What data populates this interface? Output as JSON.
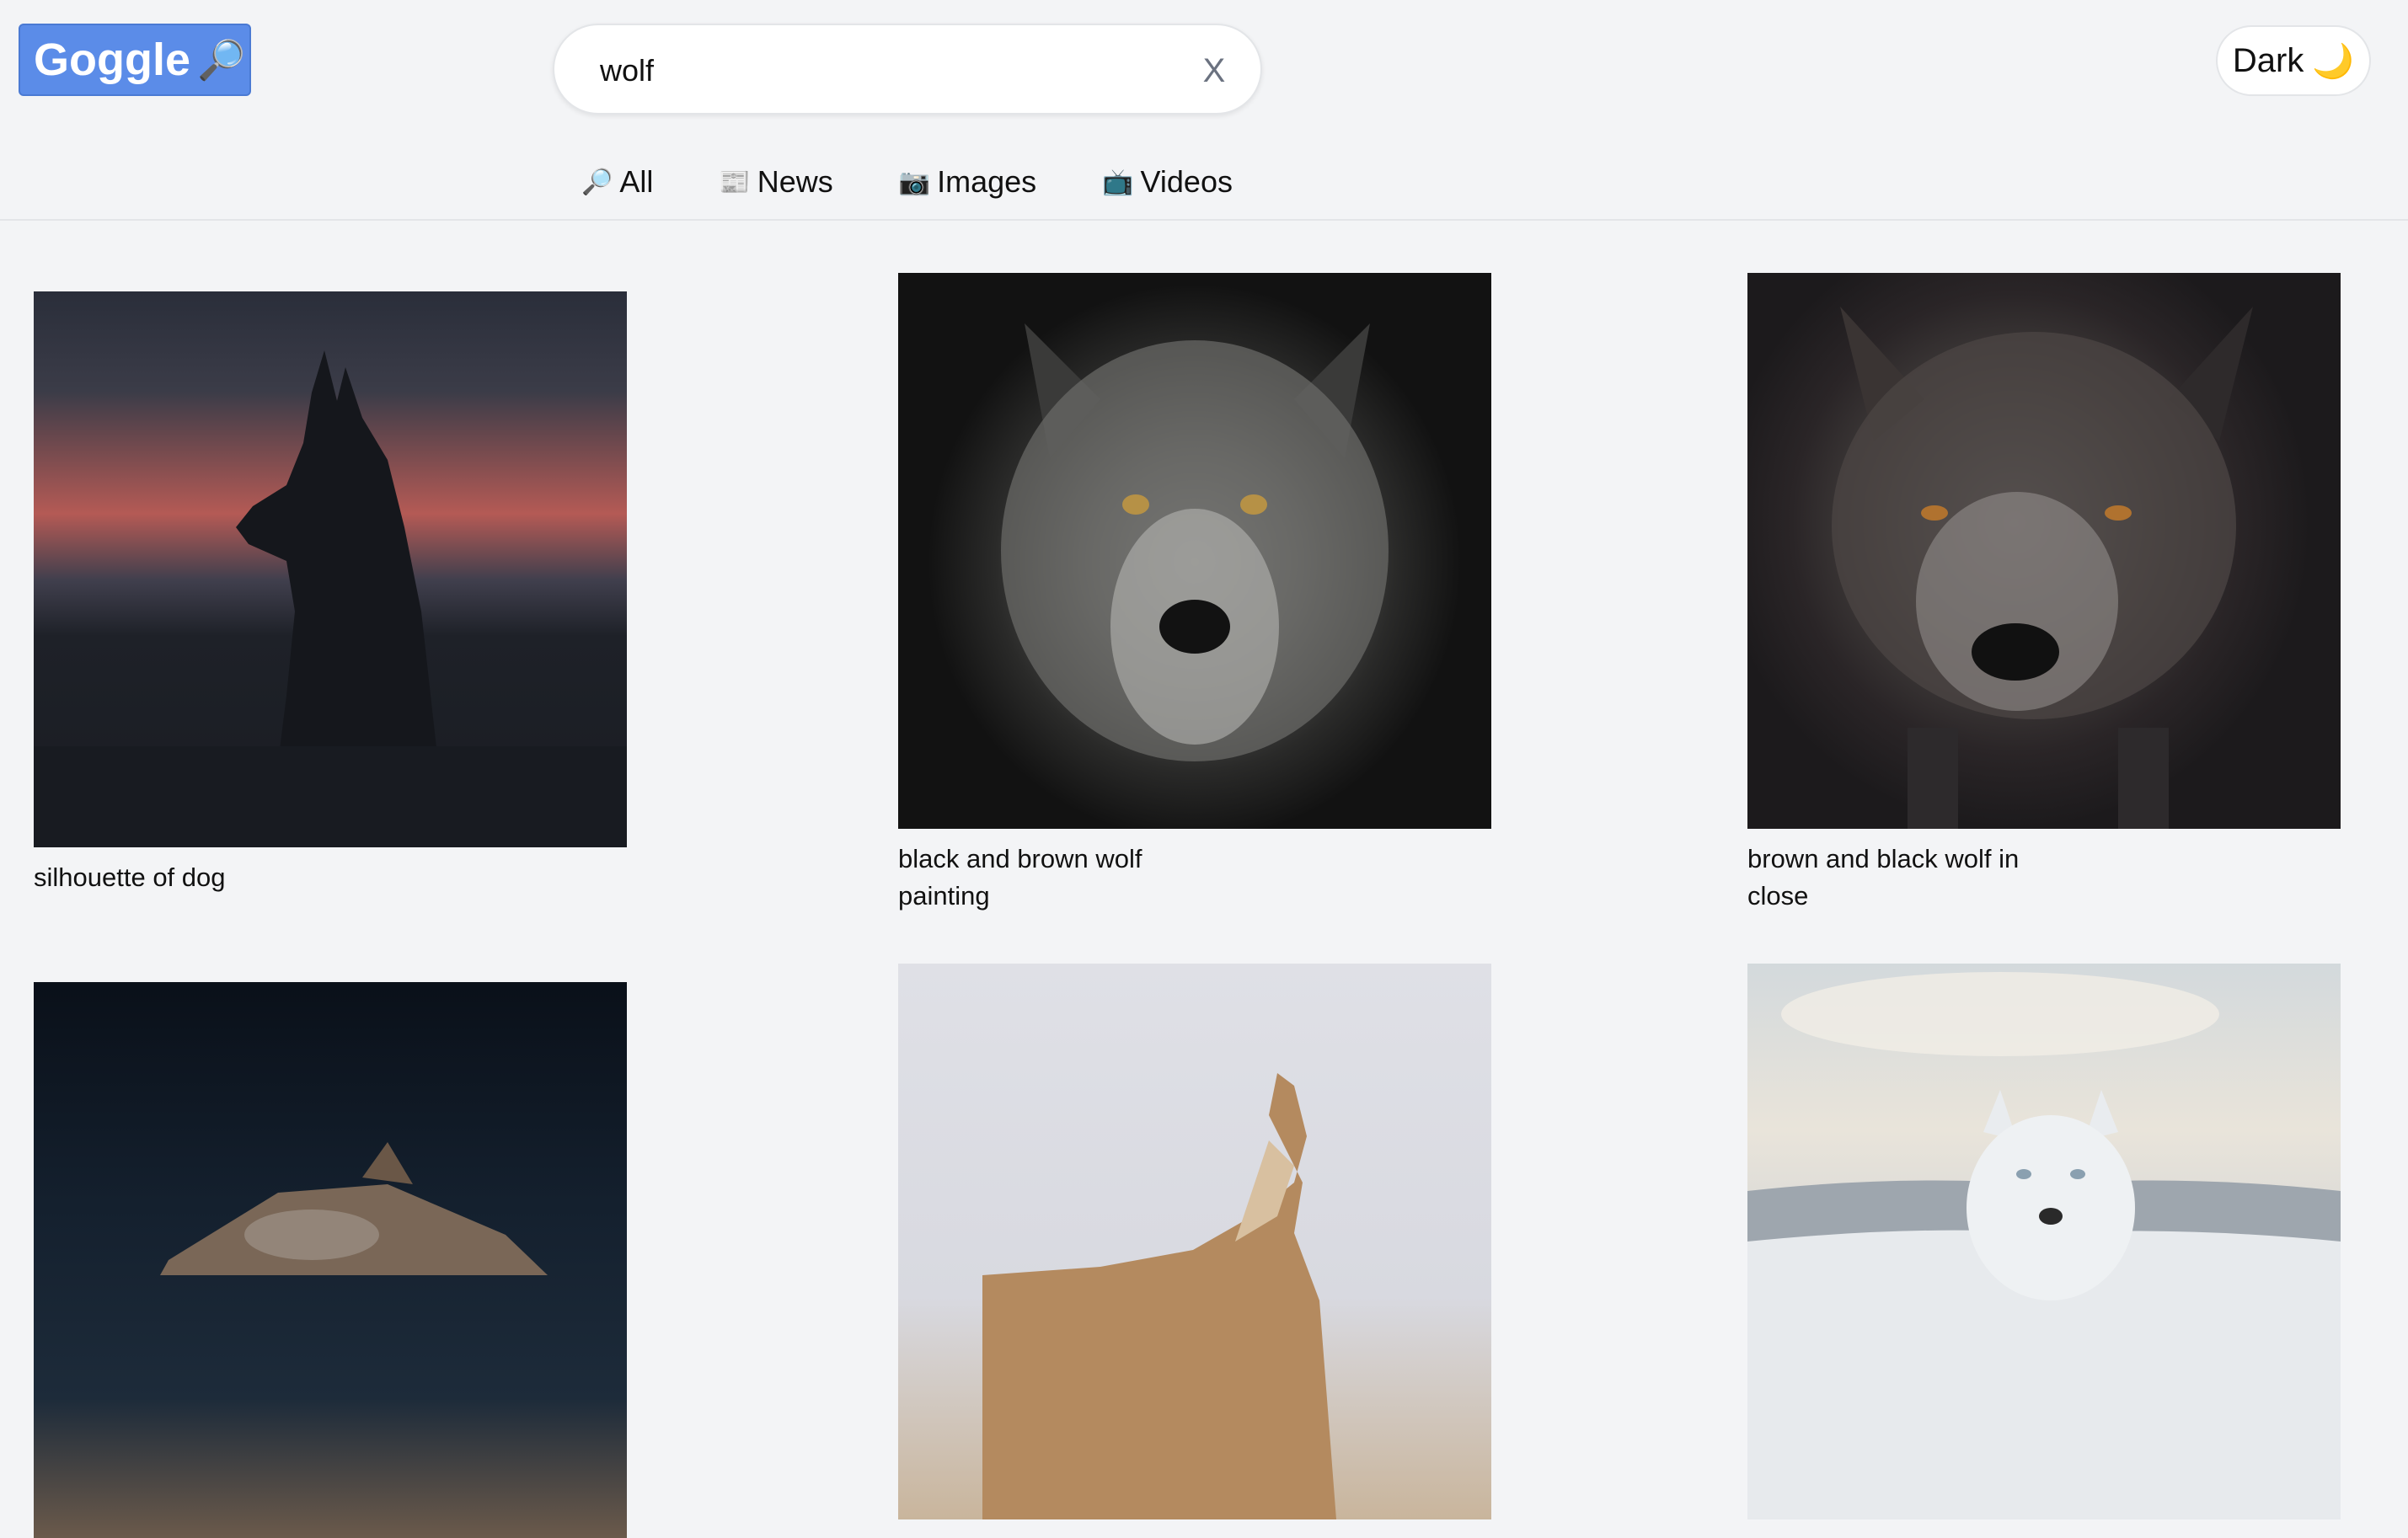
{
  "header": {
    "logo_text": "Goggle",
    "logo_icon": "🔎",
    "search_value": "wolf",
    "clear_label": "X",
    "dark_toggle_label": "Dark",
    "dark_toggle_icon": "🌙"
  },
  "tabs": [
    {
      "icon": "🔎",
      "label": "All"
    },
    {
      "icon": "📰",
      "label": "News"
    },
    {
      "icon": "📷",
      "label": "Images"
    },
    {
      "icon": "📺",
      "label": "Videos"
    }
  ],
  "results": [
    {
      "caption": "silhouette of dog"
    },
    {
      "caption": "black and brown wolf painting"
    },
    {
      "caption": "brown and black wolf in close"
    },
    {
      "caption": ""
    },
    {
      "caption": ""
    },
    {
      "caption": ""
    }
  ]
}
